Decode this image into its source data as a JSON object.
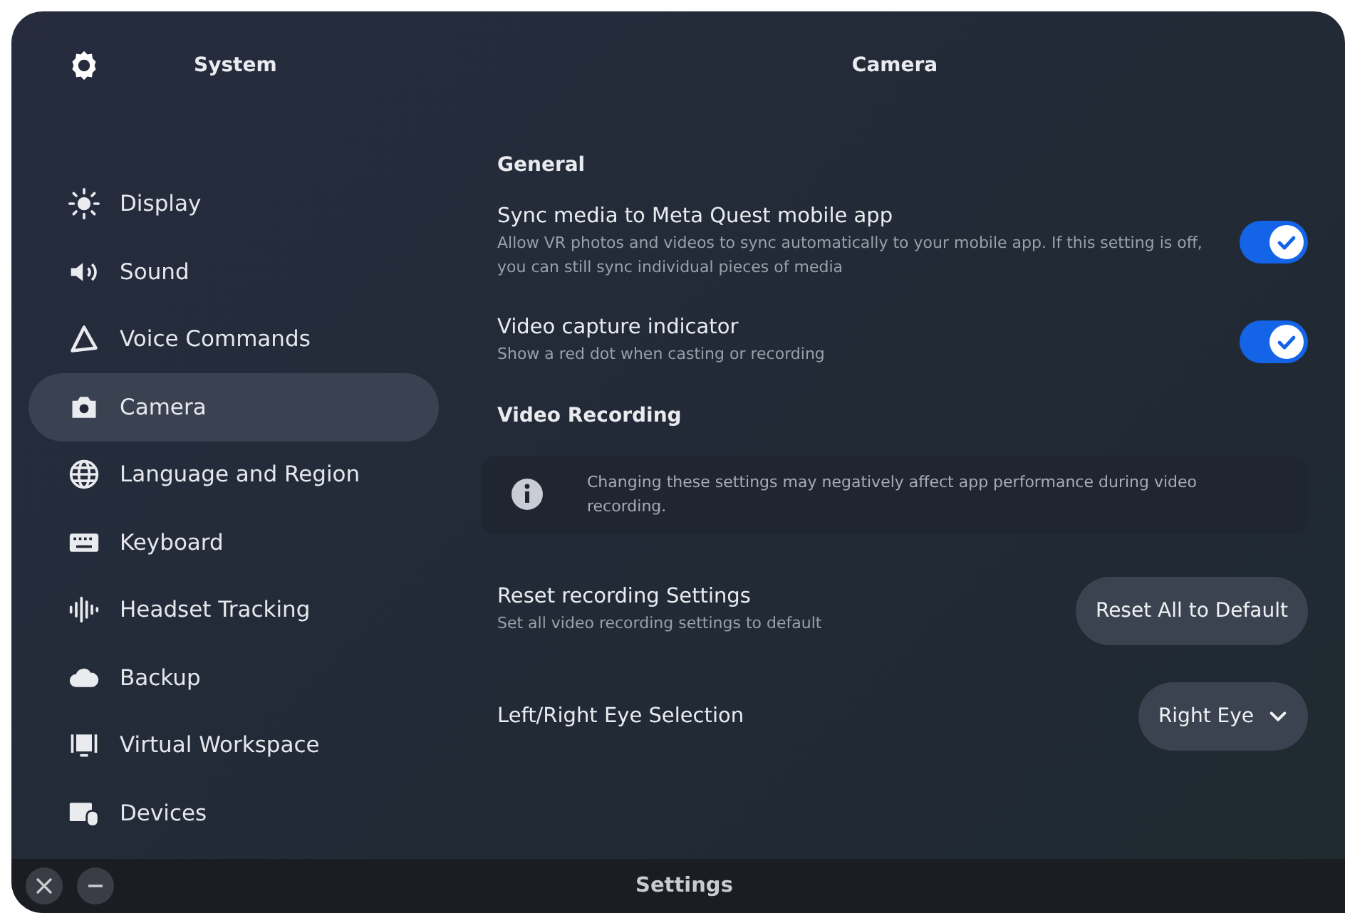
{
  "sidebar": {
    "title": "System",
    "items": [
      {
        "label": "Display",
        "selected": false
      },
      {
        "label": "Sound",
        "selected": false
      },
      {
        "label": "Voice Commands",
        "selected": false
      },
      {
        "label": "Camera",
        "selected": true
      },
      {
        "label": "Language and Region",
        "selected": false
      },
      {
        "label": "Keyboard",
        "selected": false
      },
      {
        "label": "Headset Tracking",
        "selected": false
      },
      {
        "label": "Backup",
        "selected": false
      },
      {
        "label": "Virtual Workspace",
        "selected": false
      },
      {
        "label": "Devices",
        "selected": false
      }
    ]
  },
  "page": {
    "title": "Camera",
    "sections": [
      {
        "heading": "General",
        "items": [
          {
            "kind": "toggle",
            "title": "Sync media to Meta Quest mobile app",
            "description": "Allow VR photos and videos to sync automatically to your mobile app. If this setting is off, you can still sync individual pieces of media",
            "on": true
          },
          {
            "kind": "toggle",
            "title": "Video capture indicator",
            "description": "Show a red dot when casting or recording",
            "on": true
          }
        ]
      },
      {
        "heading": "Video Recording",
        "items": [
          {
            "kind": "notice",
            "text": "Changing these settings may negatively affect app performance during video recording."
          },
          {
            "kind": "button",
            "title": "Reset recording Settings",
            "description": "Set all video recording settings to default",
            "action": "Reset All to Default"
          },
          {
            "kind": "dropdown",
            "title": "Left/Right Eye Selection",
            "value": "Right Eye"
          }
        ]
      }
    ]
  },
  "bottom_bar": {
    "title": "Settings"
  }
}
